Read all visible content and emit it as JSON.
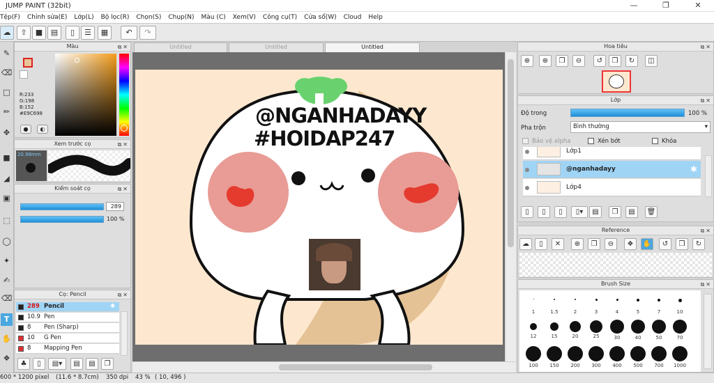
{
  "window": {
    "title": "JUMP PAINT (32bit)",
    "minimize_icon": "minimize-icon",
    "maximize_icon": "restore-icon",
    "close_icon": "close-icon"
  },
  "menu": [
    "Tệp(F)",
    "Chỉnh sửa(E)",
    "Lớp(L)",
    "Bộ lọc(R)",
    "Chọn(S)",
    "Chụp(N)",
    "Màu (C)",
    "Xem(V)",
    "Công cụ(T)",
    "Cửa sổ(W)",
    "Cloud",
    "Help"
  ],
  "tabs": [
    "Untitled",
    "Untitled",
    "Untitled"
  ],
  "color_panel": {
    "title": "Màu",
    "r": "R:233",
    "g": "G:198",
    "b": "B:152",
    "hex": "#E9C698",
    "main_color": "#e9c698"
  },
  "brush_preview": {
    "title": "Xem trước cọ",
    "size": "20.98mm"
  },
  "brush_control": {
    "title": "Kiểm soát cọ",
    "size": "289",
    "opacity": "100 %"
  },
  "brush_list": {
    "title": "Cọ: Pencil",
    "items": [
      {
        "size": "289",
        "name": "Pencil",
        "color": "#222222"
      },
      {
        "size": "10.9",
        "name": "Pen",
        "color": "#222222"
      },
      {
        "size": "8",
        "name": "Pen (Sharp)",
        "color": "#222222"
      },
      {
        "size": "10",
        "name": "G Pen",
        "color": "#e03030"
      },
      {
        "size": "8",
        "name": "Mapping Pen",
        "color": "#e03030"
      }
    ]
  },
  "canvas_text": {
    "line1": "@NGANHADAYY",
    "line2": "#HOIDAP247",
    "face": "• ω •"
  },
  "navigator": {
    "title": "Hoa tiêu"
  },
  "layers": {
    "title": "Lớp",
    "opacity_label": "Độ trong",
    "opacity_value": "100 %",
    "blend_label": "Pha trộn",
    "blend_value": "Bình thường",
    "protect_alpha": "Bảo vệ alpha",
    "clip": "Xén bớt",
    "lock": "Khóa",
    "items": [
      "Lớp1",
      "@nganhadayy",
      "Lớp4"
    ]
  },
  "reference": {
    "title": "Reference"
  },
  "brush_size": {
    "title": "Brush Size",
    "small": [
      "1",
      "1.5",
      "2",
      "3",
      "4",
      "5",
      "7",
      "10"
    ],
    "medium": [
      "12",
      "15",
      "20",
      "25",
      "30",
      "40",
      "50",
      "70"
    ],
    "large": [
      "100",
      "150",
      "200",
      "300",
      "400",
      "500",
      "700",
      "1000"
    ]
  },
  "status": {
    "pixels": "600 * 1200 pixel",
    "dimensions": "(11.6 * 8.7cm)",
    "dpi": "350 dpi",
    "zoom": "43 %",
    "cursor": "( 10, 496 )"
  }
}
